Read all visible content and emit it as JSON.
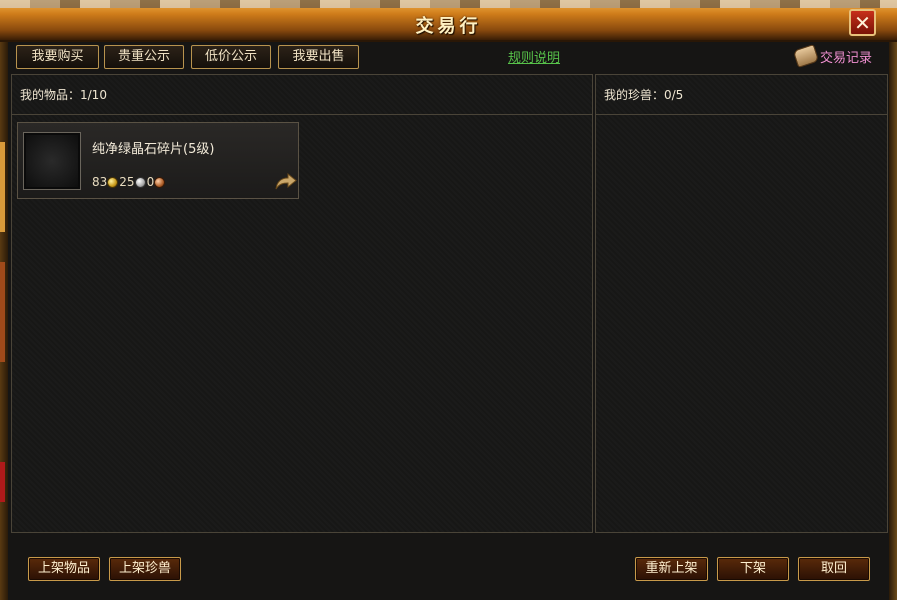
{
  "window": {
    "title": "交易行",
    "close_symbol": "✕"
  },
  "tabs": [
    {
      "label": "我要购买"
    },
    {
      "label": "贵重公示"
    },
    {
      "label": "低价公示"
    },
    {
      "label": "我要出售"
    }
  ],
  "rules_link": "规则说明",
  "trade_record": {
    "label": "交易记录",
    "icon": "scroll-icon"
  },
  "items_panel": {
    "header": "我的物品：1/10",
    "items": [
      {
        "name": "纯净绿晶石碎片(5级)",
        "price": {
          "gold": "83",
          "silver": "25",
          "copper": "0"
        },
        "action_icon": "share-arrow-icon"
      }
    ]
  },
  "pets_panel": {
    "header": "我的珍兽：0/5"
  },
  "bottom_buttons": {
    "list_item": "上架物品",
    "list_pet": "上架珍兽",
    "relist": "重新上架",
    "delist": "下架",
    "cancel": "取回"
  },
  "colors": {
    "title_gradient_top": "#f4b24a",
    "title_gradient_bottom": "#3a1e06",
    "border_gold": "#b8934e",
    "link_green": "#57c24a",
    "record_pink": "#ef8fd0",
    "close_red": "#c7301a"
  }
}
